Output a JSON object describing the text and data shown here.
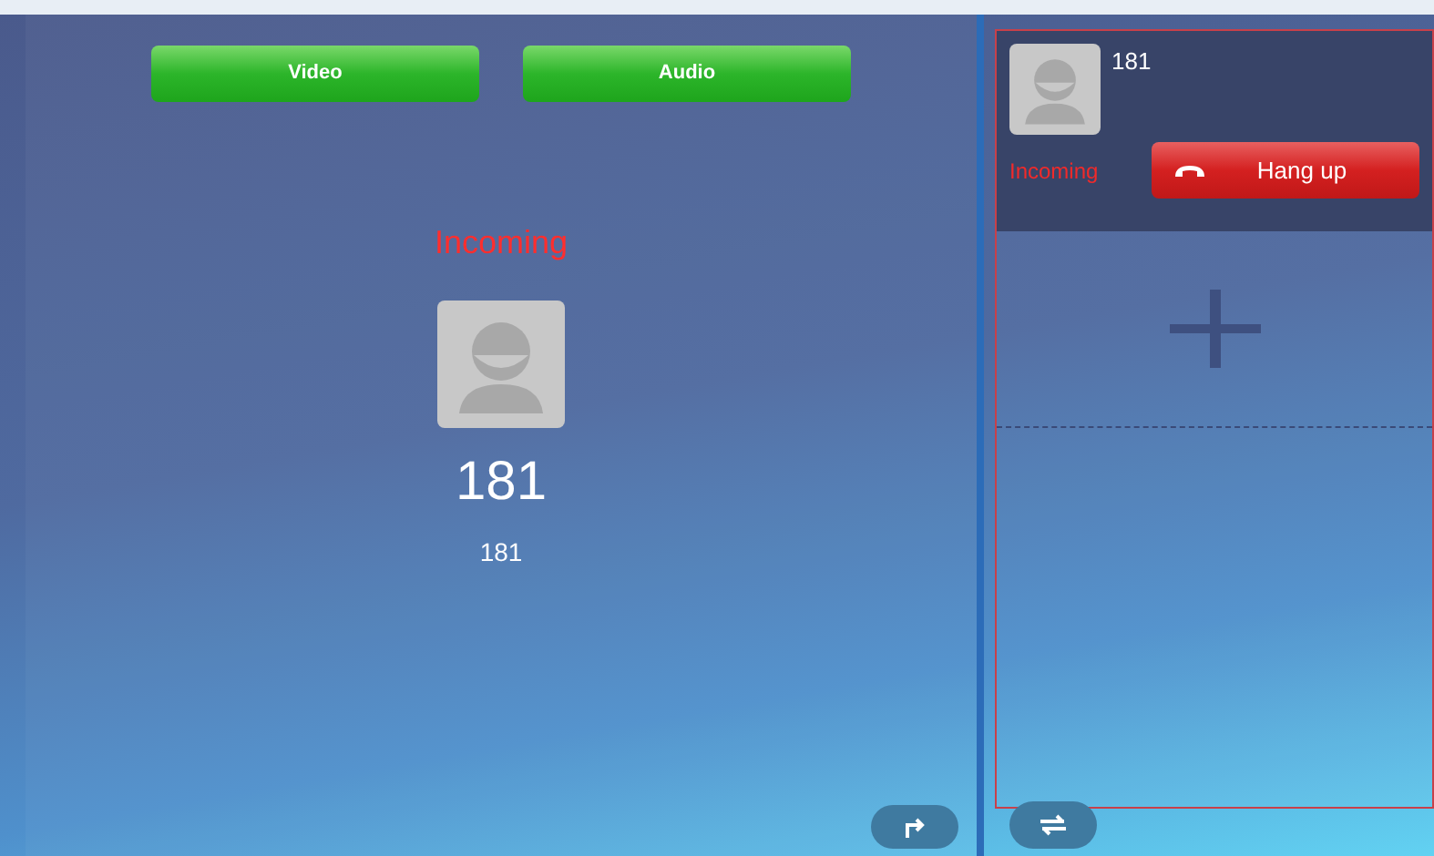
{
  "actions": [
    {
      "label": "Video"
    },
    {
      "label": "Audio"
    }
  ],
  "caller": {
    "status": "Incoming",
    "name": "181",
    "number": "181"
  },
  "calls": [
    {
      "number": "181",
      "status": "Incoming",
      "hangup": "Hang up",
      "selected": true
    }
  ]
}
